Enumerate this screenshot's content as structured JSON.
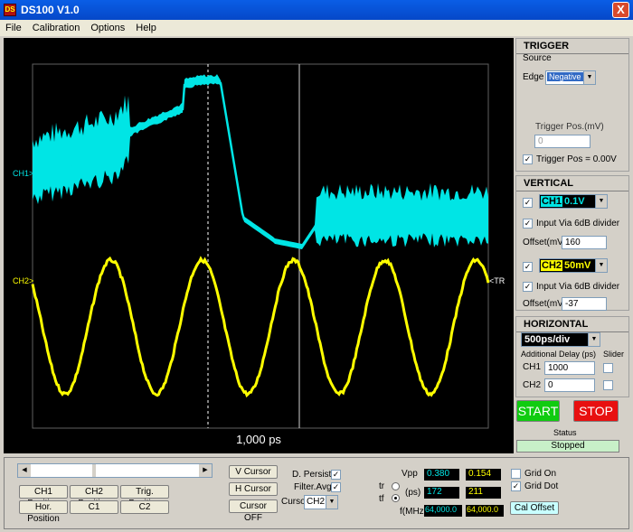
{
  "window": {
    "title": "DS100 V1.0",
    "close_label": "X",
    "icon_text": "DS"
  },
  "menu": [
    "File",
    "Calibration",
    "Options",
    "Help"
  ],
  "scope": {
    "ch1_label": "CH1>",
    "ch2_label": "CH2>",
    "trigger_marker": "<TR",
    "timebase_label": "1,000 ps"
  },
  "trigger": {
    "title": "TRIGGER",
    "source_label": "Source",
    "edge_label": "Edge",
    "edge_value": "Negative",
    "pos_label": "Trigger Pos.(mV)",
    "pos_value": "0",
    "pos_zero_label": "Trigger Pos = 0.00V",
    "pos_zero_checked": true
  },
  "vertical": {
    "title": "VERTICAL",
    "ch1": {
      "name": "CH1",
      "scale": "0.1V",
      "color": "#00e5e5",
      "divider_label": "Input Via 6dB divider",
      "divider_checked": true,
      "offset_label": "Offset(mV)",
      "offset_value": "160",
      "enabled": true
    },
    "ch2": {
      "name": "CH2",
      "scale": "50mV",
      "color": "#ffff00",
      "divider_label": "Input Via 6dB divider",
      "divider_checked": true,
      "offset_label": "Offset(mV)",
      "offset_value": "-37",
      "enabled": true
    }
  },
  "horizontal": {
    "title": "HORIZONTAL",
    "timebase": "500ps/div",
    "delay_label": "Additional Delay (ps)",
    "slider_label": "Slider",
    "ch1_label": "CH1",
    "ch1_delay": "1000",
    "ch2_label": "CH2",
    "ch2_delay": "0"
  },
  "controls": {
    "start_label": "START",
    "stop_label": "STOP",
    "status_label": "Status",
    "status_value": "Stopped"
  },
  "bottom": {
    "buttons": {
      "ch1_position": "CH1 Position",
      "ch2_position": "CH2 Position",
      "trig_position": "Trig. Position",
      "hor_position": "Hor. Position",
      "c1": "C1",
      "c2": "C2"
    },
    "cursor_buttons": {
      "v_cursor": "V Cursor",
      "h_cursor": "H Cursor",
      "cursor_off": "Cursor OFF"
    },
    "d_persist_label": "D. Persist",
    "d_persist_checked": true,
    "filter_avg_label": "Filter.Avg",
    "filter_avg_checked": true,
    "cursor_label": "Cursor",
    "cursor_value": "CH2",
    "tr_label": "tr",
    "tf_label": "tf",
    "ps_label": "(ps)",
    "vpp_label": "Vpp",
    "fmhz_label": "f(MHz)",
    "measurements": {
      "ch1": {
        "vpp": "0.380",
        "tr_tf": "172",
        "freq": "64,000.0"
      },
      "ch2": {
        "vpp": "0.154",
        "tr_tf": "211",
        "freq": "64,000.0"
      }
    },
    "grid_on_label": "Grid On",
    "grid_on_checked": false,
    "grid_dot_label": "Grid Dot",
    "grid_dot_checked": true,
    "cal_offset_label": "Cal Offset"
  }
}
